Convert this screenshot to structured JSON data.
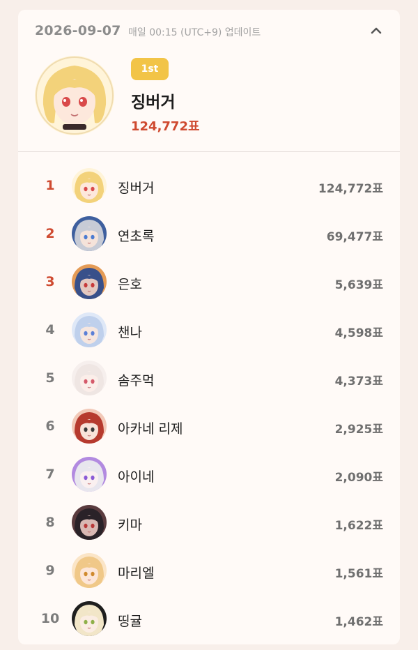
{
  "header": {
    "date": "2026-09-07",
    "update_note": "매일 00:15 (UTC+9) 업데이트",
    "collapse_icon": "chevron-up-icon"
  },
  "top": {
    "badge": "1st",
    "name": "징버거",
    "votes": "124,772표"
  },
  "rankings": [
    {
      "rank": "1",
      "name": "징버거",
      "votes": "124,772표",
      "hot": true,
      "hair": "#f3d27a",
      "skin": "#fde8dc",
      "eye": "#d94a4a",
      "bg": "#fff4d9"
    },
    {
      "rank": "2",
      "name": "연초록",
      "votes": "69,477표",
      "hot": true,
      "hair": "#c7cbd6",
      "skin": "#f5e3da",
      "eye": "#4c7bd1",
      "bg": "#3e5f9e"
    },
    {
      "rank": "3",
      "name": "은호",
      "votes": "5,639표",
      "hot": true,
      "hair": "#38508a",
      "skin": "#e3c8c0",
      "eye": "#c73a3a",
      "bg": "#e49b56"
    },
    {
      "rank": "4",
      "name": "챈나",
      "votes": "4,598표",
      "hot": false,
      "hair": "#bfd0ec",
      "skin": "#f6e6df",
      "eye": "#5b7fd6",
      "bg": "#dfe8f7"
    },
    {
      "rank": "5",
      "name": "솜주먹",
      "votes": "4,373표",
      "hot": false,
      "hair": "#efe6e3",
      "skin": "#fbeee9",
      "eye": "#d45a6a",
      "bg": "#f6efed"
    },
    {
      "rank": "6",
      "name": "아카네 리제",
      "votes": "2,925표",
      "hot": false,
      "hair": "#b63a2e",
      "skin": "#f8e2d8",
      "eye": "#3a3a3a",
      "bg": "#f2c9b8"
    },
    {
      "rank": "7",
      "name": "아이네",
      "votes": "2,090표",
      "hot": false,
      "hair": "#e8e6ee",
      "skin": "#faf0f0",
      "eye": "#8a5ad6",
      "bg": "#b28ae0"
    },
    {
      "rank": "8",
      "name": "키마",
      "votes": "1,622표",
      "hot": false,
      "hair": "#2a2228",
      "skin": "#d9b8b3",
      "eye": "#b83838",
      "bg": "#5a3b3e"
    },
    {
      "rank": "9",
      "name": "마리엘",
      "votes": "1,561표",
      "hot": false,
      "hair": "#f0c888",
      "skin": "#fde6d8",
      "eye": "#d08a2e",
      "bg": "#fbe5c7"
    },
    {
      "rank": "10",
      "name": "띵귤",
      "votes": "1,462표",
      "hot": false,
      "hair": "#f2e6c8",
      "skin": "#fbede3",
      "eye": "#8fb04a",
      "bg": "#1e1e1e"
    }
  ]
}
